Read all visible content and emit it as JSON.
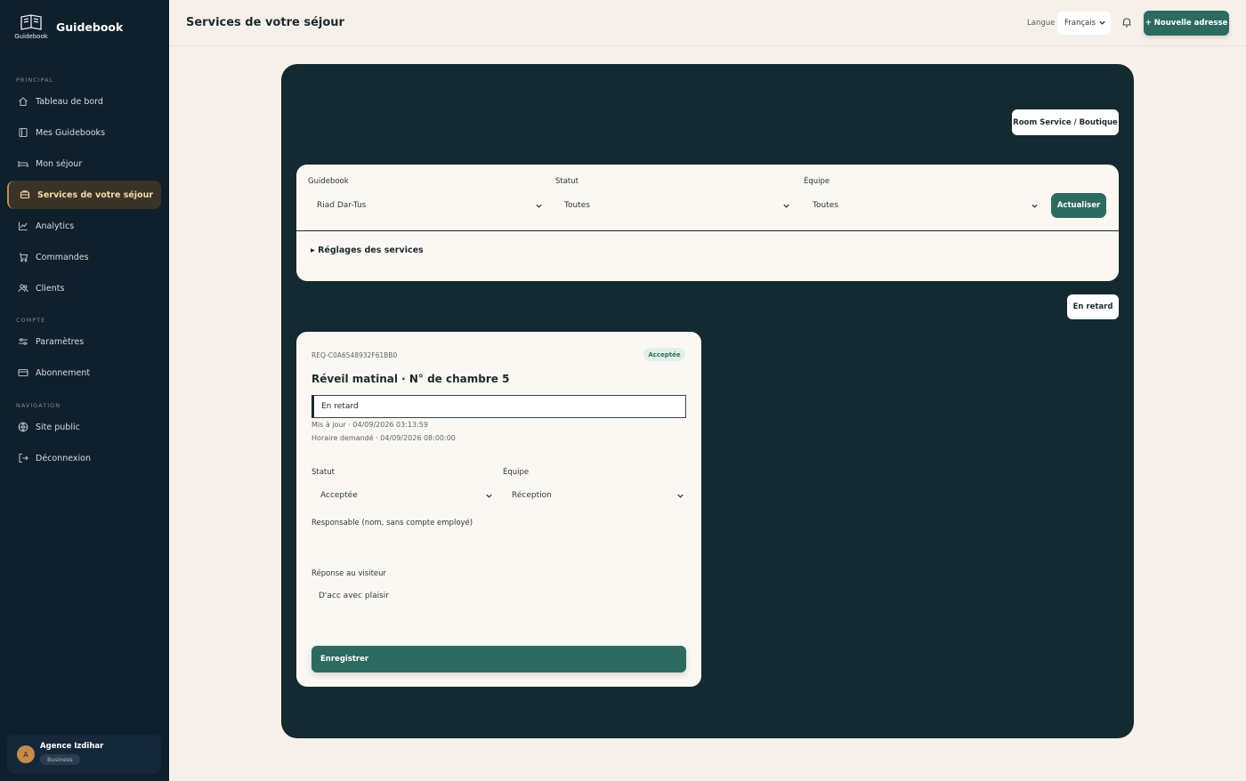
{
  "brand": {
    "name": "Guidebook",
    "logo_caption": "Guidebook"
  },
  "sidebar": {
    "sections": [
      "PRINCIPAL",
      "COMPTE",
      "NAVIGATION"
    ],
    "items": [
      {
        "label": "Tableau de bord",
        "icon": "home-icon"
      },
      {
        "label": "Mes Guidebooks",
        "icon": "book-icon"
      },
      {
        "label": "Mon séjour",
        "icon": "bed-icon"
      },
      {
        "label": "Services de votre séjour",
        "icon": "concierge-icon",
        "active": true
      },
      {
        "label": "Analytics",
        "icon": "chart-icon"
      },
      {
        "label": "Commandes",
        "icon": "orders-icon"
      },
      {
        "label": "Clients",
        "icon": "users-icon"
      },
      {
        "label": "Paramètres",
        "icon": "sliders-icon"
      },
      {
        "label": "Abonnement",
        "icon": "card-icon"
      },
      {
        "label": "Site public",
        "icon": "globe-icon"
      },
      {
        "label": "Déconnexion",
        "icon": "logout-icon"
      }
    ],
    "user": {
      "initial": "A",
      "name": "Agence Izdihar",
      "plan": "Business"
    }
  },
  "header": {
    "title": "Services de votre séjour",
    "language_label": "Langue",
    "language_value": "Français",
    "new_button": "+ Nouvelle adresse"
  },
  "panel": {
    "room_service_button": "Room Service / Boutique",
    "filters": {
      "guidebook_label": "Guidebook",
      "guidebook_value": "Riad Dar-Tus",
      "status_label": "Statut",
      "status_value": "Toutes",
      "team_label": "Équipe",
      "team_value": "Toutes",
      "refresh_button": "Actualiser"
    },
    "settings_toggle": "▸ Réglages des services",
    "late_button": "En retard",
    "request": {
      "id": "REQ-C0A6548932F61BB0",
      "badge": "Acceptée",
      "title": "Réveil matinal · N° de chambre 5",
      "late_label": "En retard",
      "updated": "Mis à jour · 04/09/2026 03:13:59",
      "requested_time": "Horaire demandé · 04/09/2026 08:00:00",
      "status_label": "Statut",
      "status_value": "Acceptée",
      "team_label": "Équipe",
      "team_value": "Réception",
      "responsible_label": "Responsable (nom, sans compte employé)",
      "responsible_value": "",
      "reply_label": "Réponse au visiteur",
      "reply_value": "D'acc avec plaisir",
      "save_button": "Enregistrer"
    }
  },
  "colors": {
    "sidebar_bg": "#0f1f2b",
    "panel_bg": "#142a30",
    "accent": "#2d6b60",
    "active_gold": "#b99152"
  }
}
